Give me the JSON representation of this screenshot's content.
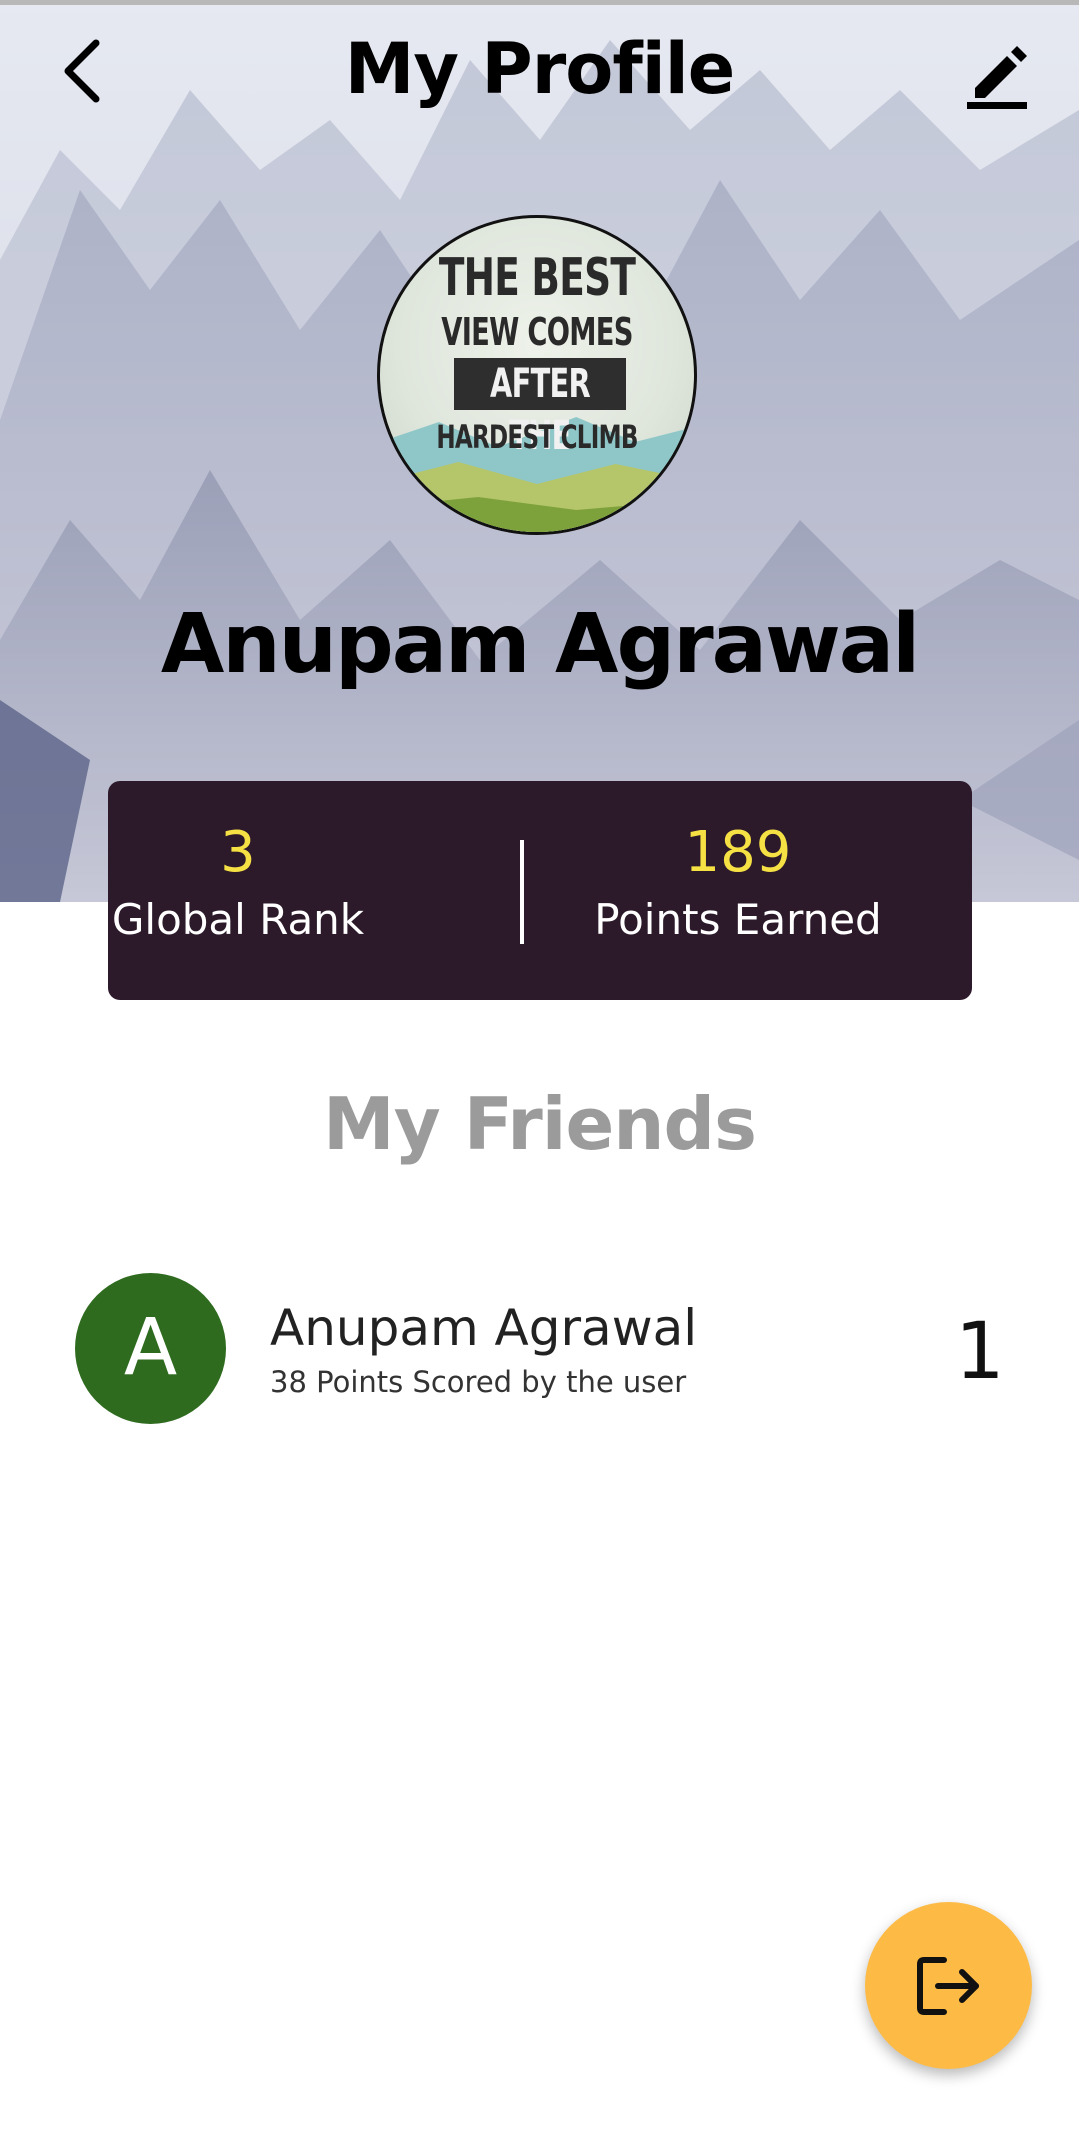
{
  "header": {
    "title": "My Profile",
    "back_icon": "chevron-left-icon",
    "edit_icon": "pencil-icon"
  },
  "profile": {
    "name": "Anupam Agrawal",
    "avatar_poster": {
      "line1": "THE BEST",
      "line2": "VIEW COMES",
      "line3": "AFTER THE",
      "line4": "HARDEST CLIMB"
    }
  },
  "stats": {
    "rank_value": "3",
    "rank_label": "Global Rank",
    "points_value": "189",
    "points_label": "Points Earned"
  },
  "friends": {
    "title": "My Friends",
    "items": [
      {
        "initial": "A",
        "name": "Anupam Agrawal",
        "subtitle": "38 Points Scored by the user",
        "rank": "1"
      }
    ]
  },
  "fab": {
    "icon": "logout-icon"
  },
  "colors": {
    "stats_bg": "#2c1a2b",
    "stat_value": "#f6e144",
    "friend_avatar": "#2e6b1f",
    "fab": "#fdbb46",
    "friends_title": "#9b9b9b"
  }
}
